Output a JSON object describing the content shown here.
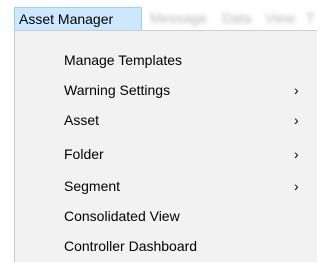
{
  "menubar": {
    "active_label": "Asset Manager",
    "blurred_labels": [
      "Message",
      "Data",
      "View",
      "T"
    ]
  },
  "dropdown": {
    "items": [
      {
        "label": "Manage Templates",
        "has_submenu": false
      },
      {
        "label": "Warning Settings",
        "has_submenu": true,
        "submenu_glyph": "›"
      },
      {
        "label": "Asset",
        "has_submenu": true,
        "submenu_glyph": "›"
      },
      {
        "label": "Folder",
        "has_submenu": true,
        "submenu_glyph": "›"
      },
      {
        "label": "Segment",
        "has_submenu": true,
        "submenu_glyph": "›"
      },
      {
        "label": "Consolidated View",
        "has_submenu": false
      },
      {
        "label": "Controller Dashboard",
        "has_submenu": false
      }
    ]
  },
  "colors": {
    "menubar_active_bg": "#cce8ff",
    "menubar_active_border": "#99d1ff",
    "dropdown_bg": "#f2f2f2",
    "dropdown_border": "#cccccc"
  }
}
